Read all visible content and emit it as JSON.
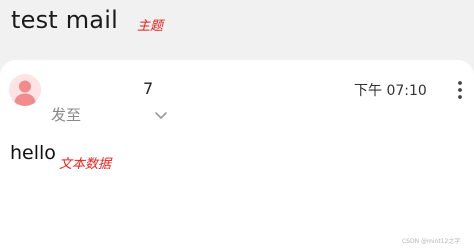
{
  "mail": {
    "subject": "test mail",
    "sender": "7",
    "send_to_label": "发至",
    "time": "下午 07:10",
    "body": "hello"
  },
  "annotations": {
    "subject_label": "主题",
    "body_label": "文本数据"
  },
  "watermark": "CSDN @mint12之字",
  "colors": {
    "annotation": "#e8201a",
    "avatar_bg": "#fde3e3",
    "avatar_fg": "#f28c8c",
    "header_bg": "#f1f1f1"
  },
  "icons": {
    "avatar": "person-icon",
    "expand": "chevron-down-icon",
    "more": "more-vertical-icon"
  }
}
